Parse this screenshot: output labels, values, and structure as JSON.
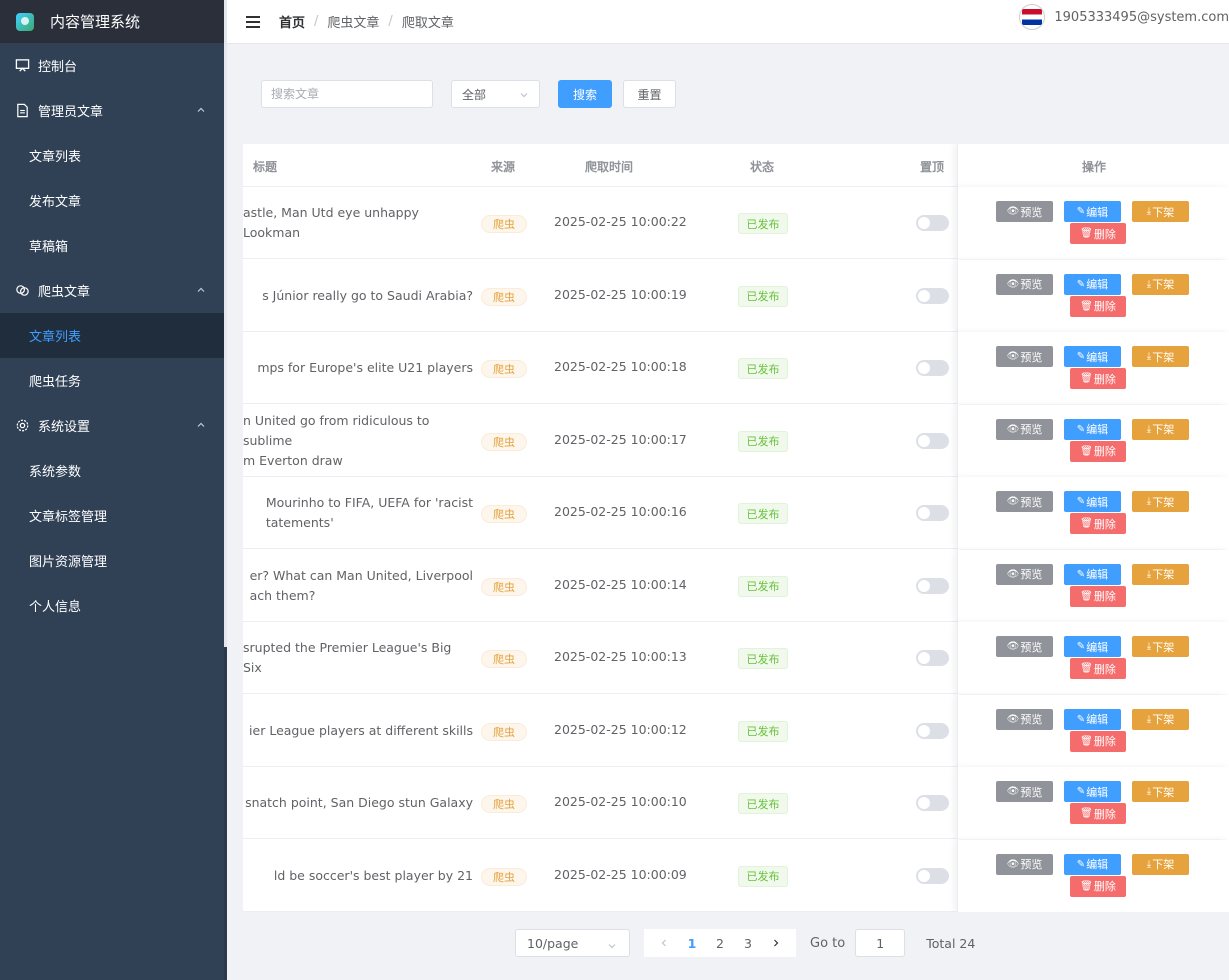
{
  "app": {
    "title": "内容管理系统"
  },
  "sidebar": {
    "items": [
      {
        "label": "控制台",
        "icon": "monitor-icon"
      },
      {
        "label": "管理员文章",
        "icon": "document-icon",
        "children": [
          "文章列表",
          "发布文章",
          "草稿箱"
        ]
      },
      {
        "label": "爬虫文章",
        "icon": "link-icon",
        "children": [
          "文章列表",
          "爬虫任务"
        ]
      },
      {
        "label": "系统设置",
        "icon": "gear-icon",
        "children": [
          "系统参数",
          "文章标签管理",
          "图片资源管理",
          "个人信息"
        ]
      }
    ],
    "active": "文章列表"
  },
  "header": {
    "breadcrumb": [
      "首页",
      "爬虫文章",
      "爬取文章"
    ],
    "user_email": "1905333495@system.com"
  },
  "search": {
    "placeholder": "搜索文章",
    "select_value": "全部",
    "search_label": "搜索",
    "reset_label": "重置"
  },
  "table": {
    "columns": [
      "标题",
      "来源",
      "爬取时间",
      "状态",
      "置顶",
      "操作"
    ],
    "action_labels": {
      "preview": "预览",
      "edit": "编辑",
      "delist": "下架",
      "delete": "删除"
    },
    "rows": [
      {
        "title": "astle, Man Utd eye unhappy Lookman",
        "source": "爬虫",
        "time": "2025-02-25 10:00:22",
        "status": "已发布",
        "pinned": false
      },
      {
        "title": "s Júnior really go to Saudi Arabia?",
        "source": "爬虫",
        "time": "2025-02-25 10:00:19",
        "status": "已发布",
        "pinned": false
      },
      {
        "title": "mps for Europe's elite U21 players",
        "source": "爬虫",
        "time": "2025-02-25 10:00:18",
        "status": "已发布",
        "pinned": false
      },
      {
        "title": "n United go from ridiculous to sublime\nm Everton draw",
        "source": "爬虫",
        "time": "2025-02-25 10:00:17",
        "status": "已发布",
        "pinned": false
      },
      {
        "title": "Mourinho to FIFA, UEFA for 'racist\ntatements'",
        "source": "爬虫",
        "time": "2025-02-25 10:00:16",
        "status": "已发布",
        "pinned": false
      },
      {
        "title": "er? What can Man United, Liverpool\nach them?",
        "source": "爬虫",
        "time": "2025-02-25 10:00:14",
        "status": "已发布",
        "pinned": false
      },
      {
        "title": "srupted the Premier League's Big Six",
        "source": "爬虫",
        "time": "2025-02-25 10:00:13",
        "status": "已发布",
        "pinned": false
      },
      {
        "title": "ier League players at different skills",
        "source": "爬虫",
        "time": "2025-02-25 10:00:12",
        "status": "已发布",
        "pinned": false
      },
      {
        "title": "snatch point, San Diego stun Galaxy",
        "source": "爬虫",
        "time": "2025-02-25 10:00:10",
        "status": "已发布",
        "pinned": false
      },
      {
        "title": "ld be soccer's best player by 21",
        "source": "爬虫",
        "time": "2025-02-25 10:00:09",
        "status": "已发布",
        "pinned": false
      }
    ]
  },
  "pagination": {
    "page_size": "10/page",
    "pages": [
      "1",
      "2",
      "3"
    ],
    "current": "1",
    "goto_label": "Go to",
    "goto_value": "1",
    "total": "Total 24"
  },
  "colors": {
    "primary": "#409eff",
    "sidebar_bg": "#304156",
    "warning": "#e6a23c",
    "danger": "#f56c6c",
    "success": "#67c23a",
    "info": "#909399"
  }
}
